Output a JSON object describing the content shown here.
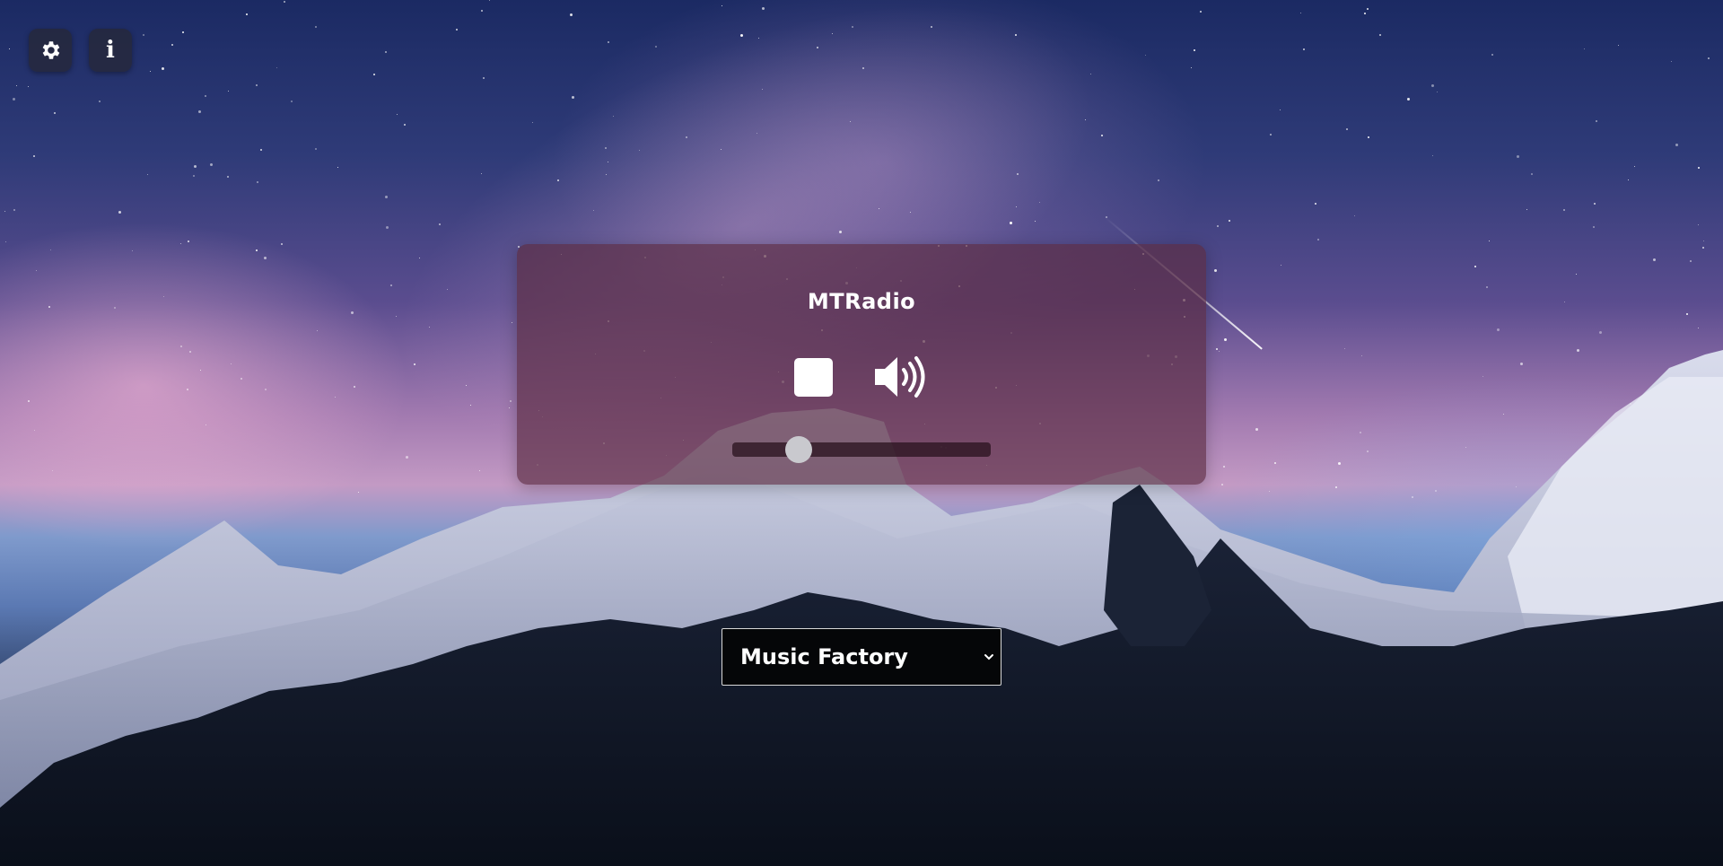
{
  "app": {
    "title": "MTRadio"
  },
  "toolbar": {
    "settings_icon": "gear-icon",
    "info_icon": "info-icon",
    "info_glyph": "i"
  },
  "player": {
    "stop_icon": "stop-icon",
    "volume_icon": "volume-icon",
    "volume_level": 0.23
  },
  "station": {
    "selected": "Music Factory",
    "dropdown_icon": "chevron-down-icon"
  },
  "colors": {
    "card_background": "#5c2c42",
    "select_background": "#050608",
    "knob": "#c9c9ce"
  }
}
